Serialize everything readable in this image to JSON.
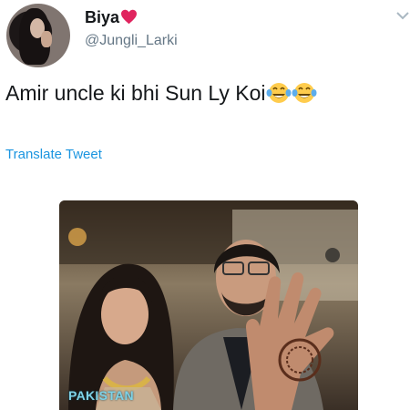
{
  "user": {
    "display_name": "Biya",
    "handle": "@Jungli_Larki"
  },
  "tweet": {
    "text": "Amir uncle ki bhi Sun Ly Koi",
    "emoji": "face-with-tears-of-joy",
    "emoji_count": 2,
    "translate_label": "Translate Tweet"
  },
  "media": {
    "watermark": "PAKISTAN"
  },
  "colors": {
    "link": "#1b95e0",
    "secondary_text": "#657786",
    "heart": "#e0245e"
  },
  "icons": [
    "heart-icon",
    "chevron-down-icon",
    "laughing-tears-emoji-icon"
  ]
}
